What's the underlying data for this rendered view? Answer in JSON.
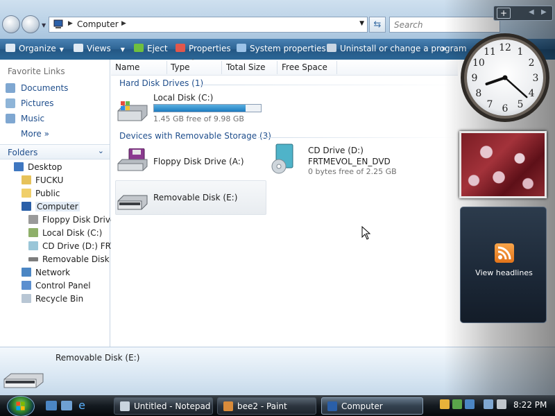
{
  "address_bar": {
    "path": "Computer",
    "search_placeholder": "Search"
  },
  "toolbar": {
    "organize": "Organize",
    "views": "Views",
    "eject": "Eject",
    "properties": "Properties",
    "system_properties": "System properties",
    "uninstall": "Uninstall or change a program",
    "overflow": "»"
  },
  "nav": {
    "favorite_links_title": "Favorite Links",
    "favorites": [
      {
        "label": "Documents",
        "icon": "documents-icon"
      },
      {
        "label": "Pictures",
        "icon": "pictures-icon"
      },
      {
        "label": "Music",
        "icon": "music-icon"
      }
    ],
    "more": "More",
    "more_chevron": "»",
    "folders_title": "Folders",
    "tree": [
      {
        "label": "Desktop",
        "icon": "desktop-icon"
      },
      {
        "label": "FUCKU",
        "icon": "user-folder-icon"
      },
      {
        "label": "Public",
        "icon": "folder-icon"
      },
      {
        "label": "Computer",
        "icon": "computer-icon"
      },
      {
        "label": "Floppy Disk Drive",
        "icon": "floppy-icon"
      },
      {
        "label": "Local Disk (C:)",
        "icon": "hard-disk-icon"
      },
      {
        "label": "CD Drive (D:) FRTI",
        "icon": "cd-drive-icon"
      },
      {
        "label": "Removable Disk (E",
        "icon": "removable-disk-icon"
      },
      {
        "label": "Network",
        "icon": "network-icon"
      },
      {
        "label": "Control Panel",
        "icon": "control-panel-icon"
      },
      {
        "label": "Recycle Bin",
        "icon": "recycle-bin-icon"
      }
    ]
  },
  "columns": [
    "Name",
    "Type",
    "Total Size",
    "Free Space"
  ],
  "groups": {
    "hard_disks": "Hard Disk Drives (1)",
    "removable": "Devices with Removable Storage (3)"
  },
  "drives": {
    "local_c": {
      "name": "Local Disk (C:)",
      "free_text": "1.45 GB free of 9.98 GB",
      "used_fraction": 0.855
    },
    "floppy": {
      "name": "Floppy Disk Drive (A:)"
    },
    "cd_drive": {
      "name": "CD Drive (D:)",
      "volume": "FRTMEVOL_EN_DVD",
      "free_text": "0 bytes free of 2.25 GB"
    },
    "removable_e": {
      "name": "Removable Disk (E:)"
    }
  },
  "details_pane": {
    "title": "Removable Disk (E:)"
  },
  "taskbar": {
    "tasks": [
      {
        "label": "Untitled - Notepad"
      },
      {
        "label": "bee2 - Paint"
      },
      {
        "label": "Computer"
      }
    ],
    "clock": "8:22 PM"
  },
  "gadgets": {
    "add": "+",
    "feed_label": "View headlines",
    "clock": {
      "hour": 8,
      "minute": 22
    },
    "clock_numbers": [
      "12",
      "1",
      "2",
      "3",
      "4",
      "5",
      "6",
      "7",
      "8",
      "9",
      "10",
      "11"
    ]
  },
  "colors": {
    "accent": "#1f4e8c",
    "toolbar": "#2b6797",
    "bar_fill": "#1d7cc0"
  }
}
